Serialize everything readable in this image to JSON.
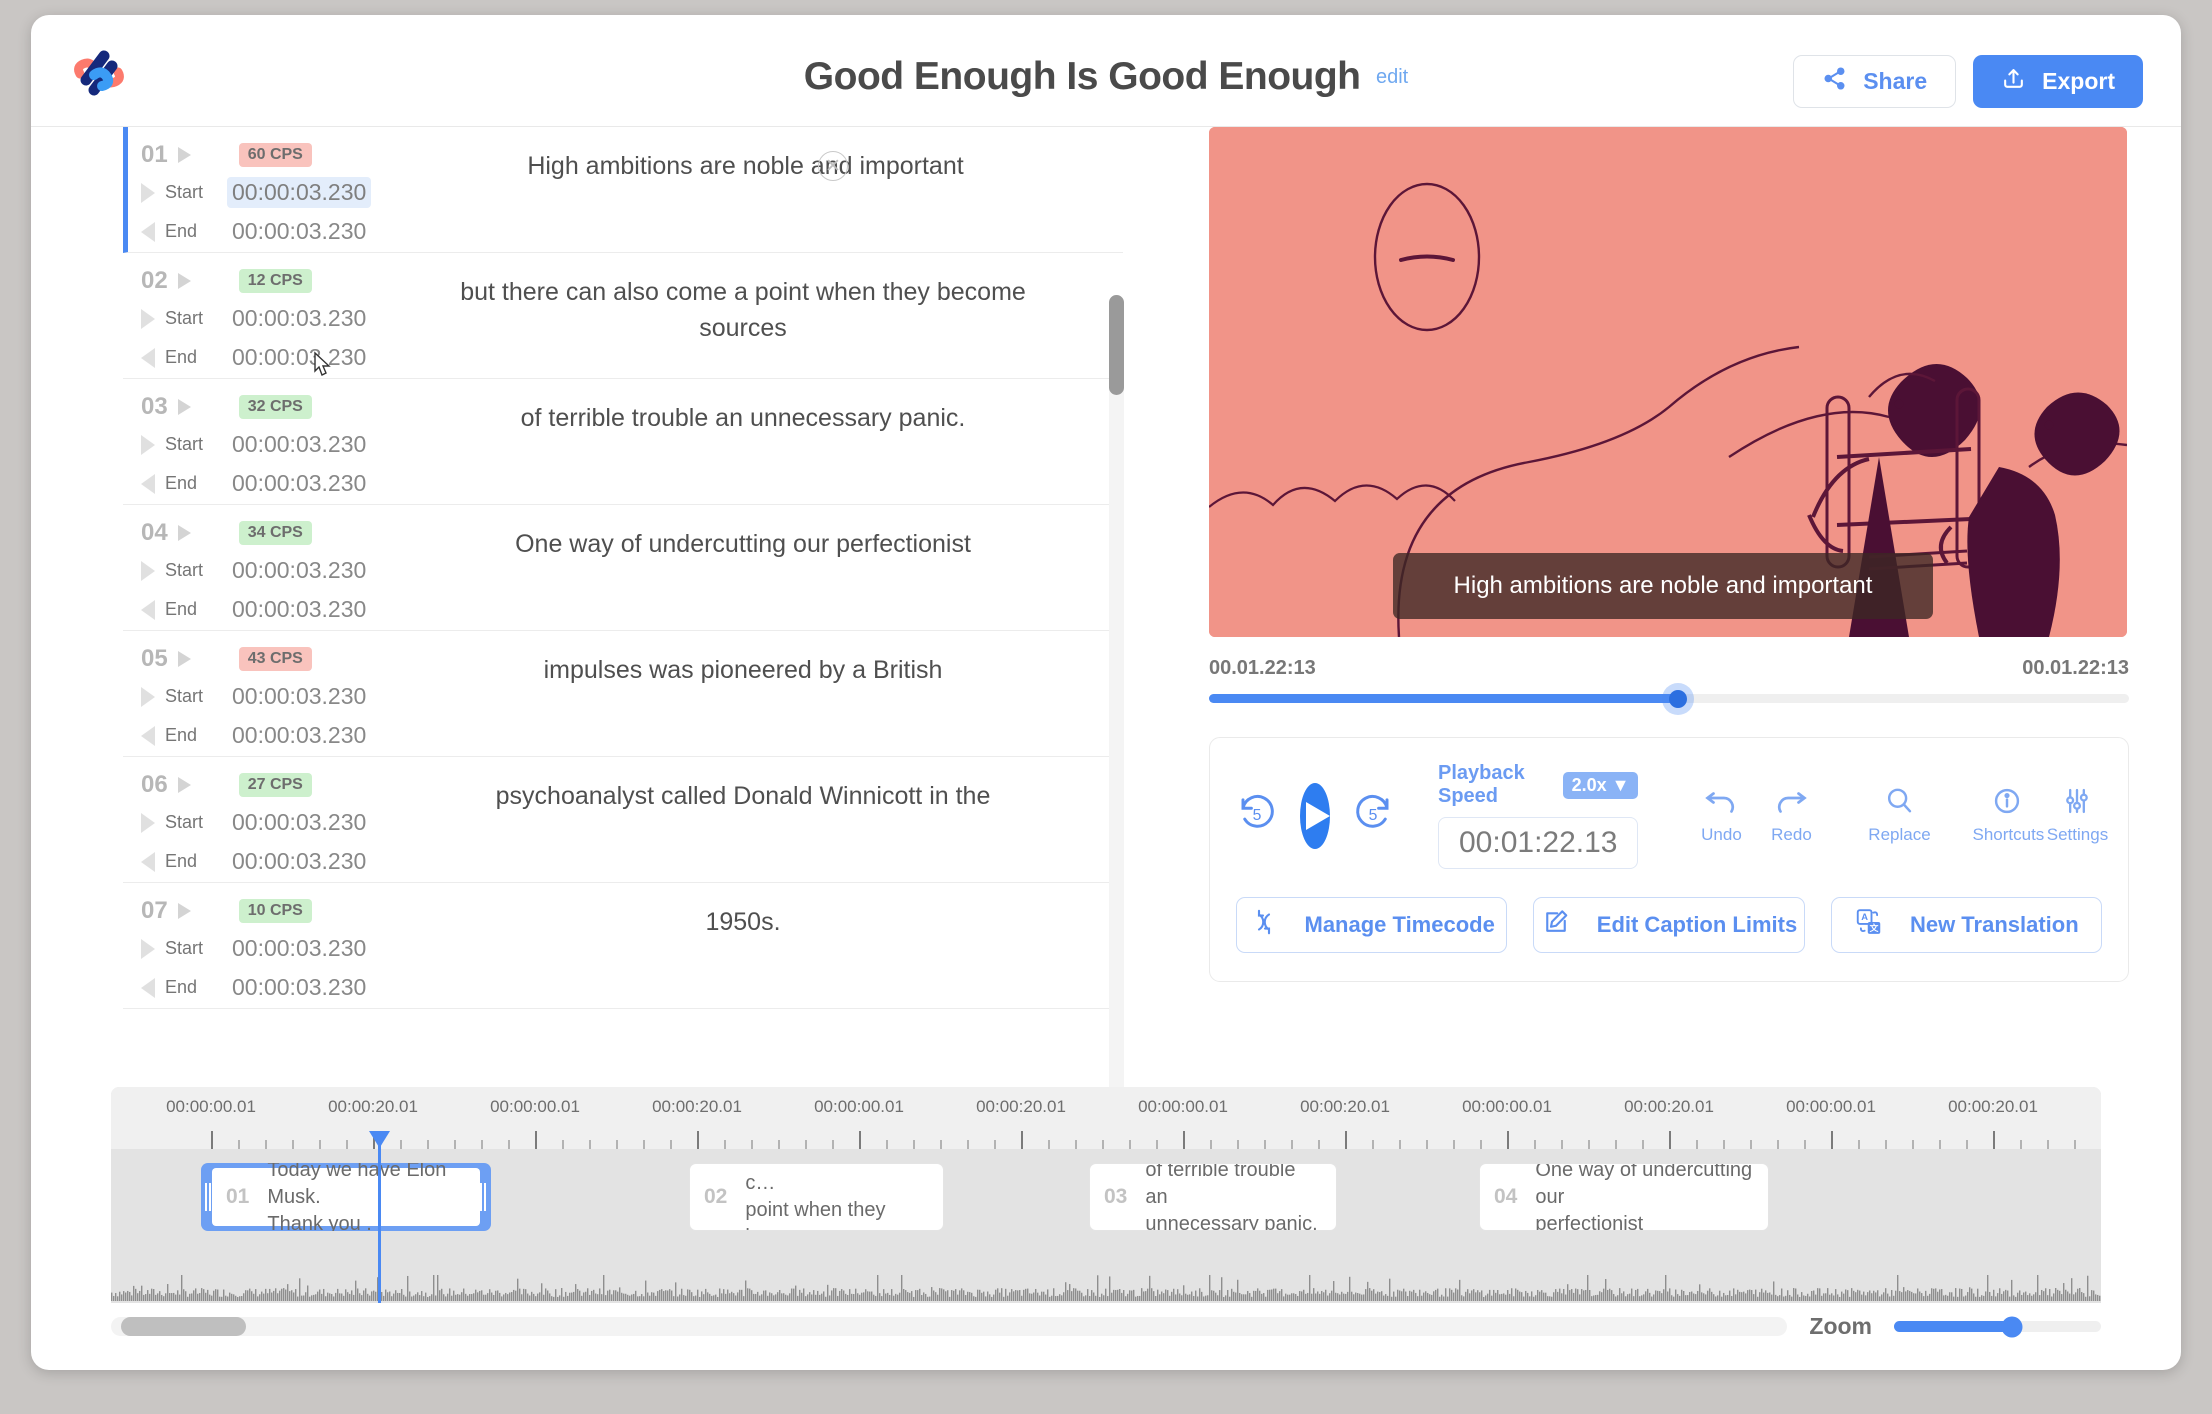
{
  "header": {
    "logo_icon": "brand-logo-icon",
    "title": "Good Enough Is Good Enough",
    "edit_label": "edit",
    "share_label": "Share",
    "share_icon": "share-icon",
    "export_label": "Export",
    "export_icon": "upload-icon",
    "accent_blue": "#4a89f3"
  },
  "captions": [
    {
      "index": "01",
      "cps": "60 CPS",
      "cps_level": "red",
      "start_label": "Start",
      "end_label": "End",
      "start": "00:00:03.230",
      "end": "00:00:03.230",
      "text": "High ambitions are noble and important",
      "active": true
    },
    {
      "index": "02",
      "cps": "12 CPS",
      "cps_level": "green",
      "start_label": "Start",
      "end_label": "End",
      "start": "00:00:03.230",
      "end": "00:00:03.230",
      "text": "but there can also come a point when they become sources",
      "active": false
    },
    {
      "index": "03",
      "cps": "32 CPS",
      "cps_level": "green",
      "start_label": "Start",
      "end_label": "End",
      "start": "00:00:03.230",
      "end": "00:00:03.230",
      "text": "of terrible trouble an unnecessary panic.",
      "active": false
    },
    {
      "index": "04",
      "cps": "34 CPS",
      "cps_level": "green",
      "start_label": "Start",
      "end_label": "End",
      "start": "00:00:03.230",
      "end": "00:00:03.230",
      "text": "One way of undercutting our perfectionist",
      "active": false
    },
    {
      "index": "05",
      "cps": "43 CPS",
      "cps_level": "red",
      "start_label": "Start",
      "end_label": "End",
      "start": "00:00:03.230",
      "end": "00:00:03.230",
      "text": "impulses was pioneered by a British",
      "active": false
    },
    {
      "index": "06",
      "cps": "27 CPS",
      "cps_level": "green",
      "start_label": "Start",
      "end_label": "End",
      "start": "00:00:03.230",
      "end": "00:00:03.230",
      "text": "psychoanalyst called Donald Winnicott in the",
      "active": false
    },
    {
      "index": "07",
      "cps": "10 CPS",
      "cps_level": "green",
      "start_label": "Start",
      "end_label": "End",
      "start": "00:00:03.230",
      "end": "00:00:03.230",
      "text": "1950s.",
      "active": false
    }
  ],
  "row_tools": {
    "add_icon": "plus-icon",
    "duplicate_icon": "copy-icon",
    "close_icon": "close-circle-icon"
  },
  "preview": {
    "caption_overlay": "High ambitions are noble and important",
    "background_color": "#f19488"
  },
  "seek": {
    "current_time": "00.01.22:13",
    "total_time": "00.01.22:13",
    "progress_percent": 51
  },
  "controls": {
    "rewind_icon": "rewind-5-icon",
    "play_icon": "play-icon",
    "forward_icon": "forward-5-icon",
    "playback_speed_label": "Playback Speed",
    "playback_speed_value": "2.0x",
    "timecode_value": "00:01:22.13",
    "tools": [
      {
        "label": "Undo",
        "icon": "undo-icon"
      },
      {
        "label": "Redo",
        "icon": "redo-icon"
      },
      {
        "label": "Replace",
        "icon": "search-icon"
      },
      {
        "label": "Shortcuts",
        "icon": "info-icon"
      },
      {
        "label": "Settings",
        "icon": "sliders-icon"
      }
    ],
    "actions": [
      {
        "label": "Manage Timecode",
        "icon": "refresh-icon"
      },
      {
        "label": "Edit Caption Limits",
        "icon": "pencil-square-icon"
      },
      {
        "label": "New Translation",
        "icon": "translate-icon"
      }
    ]
  },
  "timeline": {
    "ruler_labels": [
      "00:00:00.01",
      "00:00:20.01",
      "00:00:00.01",
      "00:00:20.01",
      "00:00:00.01",
      "00:00:20.01",
      "00:00:00.01",
      "00:00:20.01",
      "00:00:00.01",
      "00:00:20.01",
      "00:00:00.01",
      "00:00:20.01"
    ],
    "clips": [
      {
        "index": "01",
        "line1": "Today we have Elon Musk.",
        "line2": "Thank you .",
        "selected": true
      },
      {
        "index": "02",
        "line1": "but there can also c…",
        "line2": "point when they be…",
        "selected": false
      },
      {
        "index": "03",
        "line1": "of terrible trouble an",
        "line2": "unnecessary panic.",
        "selected": false
      },
      {
        "index": "04",
        "line1": "One way of undercutting our",
        "line2": "perfectionist",
        "selected": false
      }
    ],
    "zoom_label": "Zoom",
    "zoom_percent": 57
  }
}
